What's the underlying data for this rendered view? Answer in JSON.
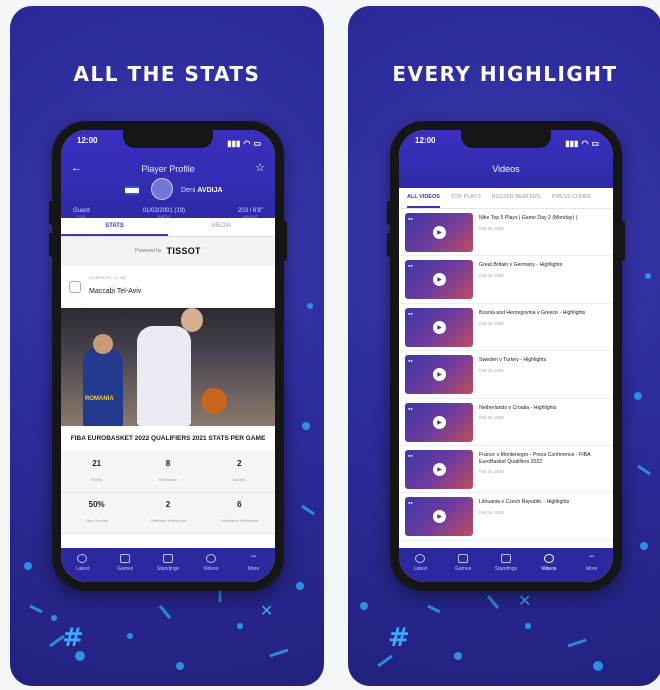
{
  "left": {
    "headline": "ALL THE STATS",
    "status_time": "12:00",
    "nav_title": "Player Profile",
    "player_first": "Deni",
    "player_last": "AVDIJA",
    "meta": [
      {
        "value": "Guard",
        "label": "POS"
      },
      {
        "value": "01/03/2001 (19)",
        "label": "BIRTH"
      },
      {
        "value": "203 / 6'8\"",
        "label": "HEIGHT"
      }
    ],
    "tabs": [
      "STATS",
      "MEDIA"
    ],
    "powered_by": "Powered by",
    "sponsor": "TISSOT",
    "club_label": "CURRENT CLUB",
    "club_name": "Maccabi Tel-Aviv",
    "photo_jersey_text": "ROMANIA",
    "stats_title": "FIBA EUROBASKET 2022 QUALIFIERS 2021 STATS PER GAME",
    "stats": [
      {
        "value": "21",
        "label": "Points"
      },
      {
        "value": "8",
        "label": "Rebounds"
      },
      {
        "value": "2",
        "label": "Assists"
      },
      {
        "value": "50%",
        "label": "Free Throws"
      },
      {
        "value": "2",
        "label": "Offensive Rebounds"
      },
      {
        "value": "6",
        "label": "Defensive Rebounds"
      }
    ]
  },
  "right": {
    "headline": "EVERY HIGHLIGHT",
    "status_time": "12:00",
    "nav_title": "Videos",
    "categories": [
      "ALL VIDEOS",
      "TOP PLAYS",
      "BUZZER BEATERS",
      "PRESS CONFE"
    ],
    "videos": [
      {
        "title": "Nike Top 5 Plays | Game Day 2 (Monday) |",
        "date": "Feb 26, 2020"
      },
      {
        "title": "Great Britain v Germany - Highlights",
        "date": "Feb 26, 2020"
      },
      {
        "title": "Bosnia and Herzegovina v Greece - Highlights",
        "date": "Feb 25, 2020"
      },
      {
        "title": "Sweden v Turkey - Highlights",
        "date": "Feb 25, 2020"
      },
      {
        "title": "Netherlands v Croatia - Highlights",
        "date": "Feb 25, 2020"
      },
      {
        "title": "France v Montenegro - Press Conference - FIBA EuroBasket Qualifiers 2022",
        "date": "Feb 24, 2020"
      },
      {
        "title": "Lithuania v Czech Republic - Highlights",
        "date": "Feb 24, 2020"
      }
    ]
  },
  "tabbar": [
    "Latest",
    "Games",
    "Standings",
    "Videos",
    "More"
  ]
}
